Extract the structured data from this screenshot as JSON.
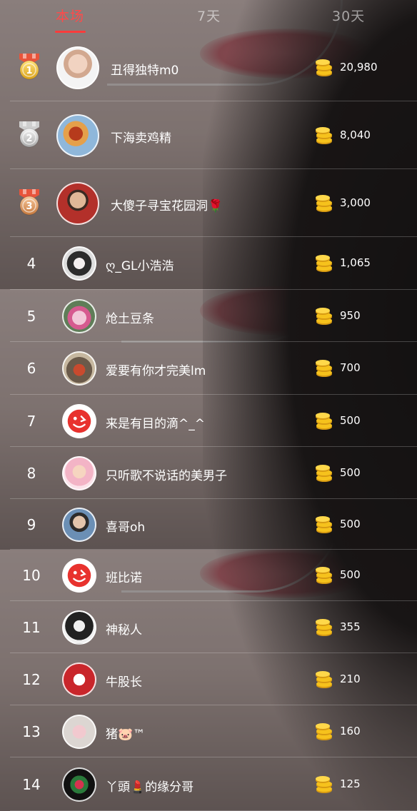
{
  "tabs": [
    {
      "label": "本场",
      "active": true
    },
    {
      "label": "7天",
      "active": false
    },
    {
      "label": "30天",
      "active": false
    }
  ],
  "accent_color": "#ff3b3b",
  "ranking": [
    {
      "rank": "1",
      "medal": "gold-medal-icon",
      "name": "丑得独特m0",
      "amount": "20,980",
      "avatar": "avatar-boy"
    },
    {
      "rank": "2",
      "medal": "silver-medal-icon",
      "name": "下海卖鸡精",
      "amount": "8,040",
      "avatar": "avatar-rooster"
    },
    {
      "rank": "3",
      "medal": "bronze-medal-icon",
      "name": "大傻子寻宝花园洞🌹",
      "amount": "3,000",
      "avatar": "avatar-man-red"
    },
    {
      "rank": "4",
      "name": "ღ_GL小浩浩",
      "amount": "1,065",
      "avatar": "avatar-anime"
    },
    {
      "rank": "5",
      "name": "炝土豆条",
      "amount": "950",
      "avatar": "avatar-lotus"
    },
    {
      "rank": "6",
      "name": "爱要有你才完美lm",
      "amount": "700",
      "avatar": "avatar-street"
    },
    {
      "rank": "7",
      "name": "来是有目的滴^_^",
      "amount": "500",
      "avatar": "avatar-default"
    },
    {
      "rank": "8",
      "name": "只听歌不说话的美男子",
      "amount": "500",
      "avatar": "avatar-cupid"
    },
    {
      "rank": "9",
      "name": "喜哥oh",
      "amount": "500",
      "avatar": "avatar-man-glasses"
    },
    {
      "rank": "10",
      "name": "班比诺",
      "amount": "500",
      "avatar": "avatar-default"
    },
    {
      "rank": "11",
      "name": "神秘人",
      "amount": "355",
      "avatar": "avatar-hat"
    },
    {
      "rank": "12",
      "name": "牛股长",
      "amount": "210",
      "avatar": "avatar-bull"
    },
    {
      "rank": "13",
      "name": "猪🐷™",
      "amount": "160",
      "avatar": "avatar-pig"
    },
    {
      "rank": "14",
      "name": "丫頭💄的缘分哥",
      "amount": "125",
      "avatar": "avatar-flowers"
    }
  ]
}
